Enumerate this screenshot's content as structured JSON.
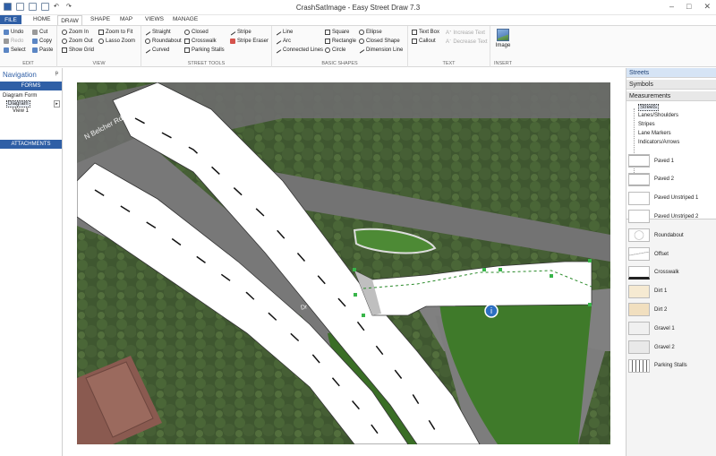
{
  "window": {
    "title": "CrashSatImage - Easy Street Draw 7.3",
    "controls": [
      "–",
      "□",
      "✕"
    ]
  },
  "tabs": [
    "FILE",
    "HOME",
    "DRAW",
    "SHAPE",
    "MAP",
    "VIEWS",
    "MANAGE"
  ],
  "ribbon": {
    "edit": {
      "label": "EDIT",
      "items": [
        "Undo",
        "Redo",
        "Select",
        "Cut",
        "Copy",
        "Paste"
      ]
    },
    "view": {
      "label": "VIEW",
      "items": [
        "Zoom In",
        "Zoom Out",
        "Show Grid",
        "Zoom to Fit",
        "Lasso Zoom"
      ]
    },
    "street_tools": {
      "label": "STREET TOOLS",
      "items": [
        "Straight",
        "Roundabout",
        "Curved",
        "Closed",
        "Crosswalk",
        "Parking Stalls",
        "Stripe",
        "Stripe Eraser"
      ]
    },
    "basic_shapes": {
      "label": "BASIC SHAPES",
      "items": [
        "Line",
        "Arc",
        "Connected Lines",
        "Square",
        "Rectangle",
        "Circle",
        "Ellipse",
        "Closed Shape",
        "Dimension Line"
      ]
    },
    "text": {
      "label": "TEXT",
      "items": [
        "Text Box",
        "Callout",
        "Increase Text",
        "Decrease Text"
      ]
    },
    "insert": {
      "label": "INSERT",
      "items": [
        "Image"
      ]
    }
  },
  "nav": {
    "title": "Navigation",
    "pin": "ᵽ",
    "forms_header": "FORMS",
    "tree": [
      "Diagram Form",
      "Diagram",
      "View 1"
    ],
    "attachments_header": "ATTACHMENTS"
  },
  "map": {
    "labels": [
      "N Belcher Rd",
      "Dr"
    ]
  },
  "right_panel": {
    "headers": [
      "Streets",
      "Symbols",
      "Measurements"
    ],
    "tree": [
      "Streets",
      "Lanes/Shoulders",
      "Stripes",
      "Lane Markers",
      "Indicators/Arrows"
    ],
    "library": [
      "Paved 1",
      "Paved 2",
      "Paved Unstriped 1",
      "Paved Unstriped 2",
      "Roundabout",
      "Offset",
      "Crosswalk",
      "Dirt 1",
      "Dirt 2",
      "Gravel 1",
      "Gravel 2",
      "Parking Stalls"
    ]
  }
}
